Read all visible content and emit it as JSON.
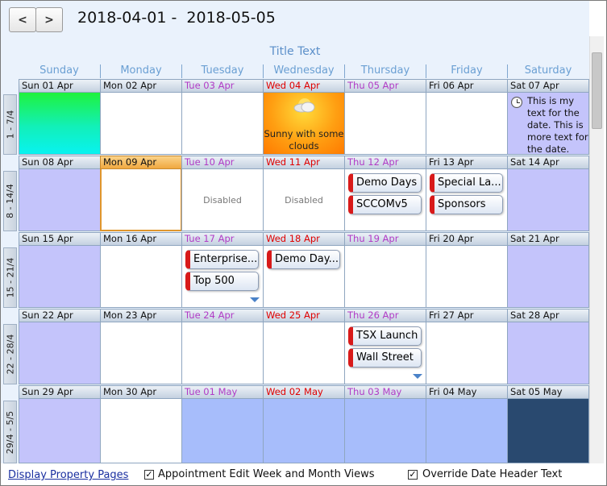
{
  "nav": {
    "prev_label": "<",
    "next_label": ">"
  },
  "date_range": "2018-04-01 -  2018-05-05",
  "title_text": "Title Text",
  "day_headers": [
    "Sunday",
    "Monday",
    "Tuesday",
    "Wednesday",
    "Thursday",
    "Friday",
    "Saturday"
  ],
  "weeks": [
    {
      "label": "1 - 7/4",
      "days": [
        "Sun 01 Apr",
        "Mon 02 Apr",
        "Tue 03 Apr",
        "Wed 04 Apr",
        "Thu 05 Apr",
        "Fri 06 Apr",
        "Sat 07 Apr"
      ]
    },
    {
      "label": "8 - 14/4",
      "days": [
        "Sun 08 Apr",
        "Mon 09 Apr",
        "Tue 10 Apr",
        "Wed 11 Apr",
        "Thu 12 Apr",
        "Fri 13 Apr",
        "Sat 14 Apr"
      ]
    },
    {
      "label": "15 - 21/4",
      "days": [
        "Sun 15 Apr",
        "Mon 16 Apr",
        "Tue 17 Apr",
        "Wed 18 Apr",
        "Thu 19 Apr",
        "Fri 20 Apr",
        "Sat 21 Apr"
      ]
    },
    {
      "label": "22 - 28/4",
      "days": [
        "Sun 22 Apr",
        "Mon 23 Apr",
        "Tue 24 Apr",
        "Wed 25 Apr",
        "Thu 26 Apr",
        "Fri 27 Apr",
        "Sat 28 Apr"
      ]
    },
    {
      "label": "29/4 - 5/5",
      "days": [
        "Sun 29 Apr",
        "Mon 30 Apr",
        "Tue 01 May",
        "Wed 02 May",
        "Thu 03 May",
        "Fri 04 May",
        "Sat 05 May"
      ]
    }
  ],
  "cells": {
    "weather": {
      "line1": "Sunny with some",
      "line2": "clouds"
    },
    "note": "This is my text for the date. This is more text for the date.",
    "disabled": "Disabled"
  },
  "appointments": {
    "thu_12": [
      "Demo Days",
      "SCCOMv5"
    ],
    "fri_13": [
      "Special La...",
      "Sponsors"
    ],
    "tue_17": [
      "Enterprise...",
      "Top 500"
    ],
    "wed_18": [
      "Demo Day..."
    ],
    "thu_26": [
      "TSX Launch",
      "Wall Street"
    ]
  },
  "bottom": {
    "link": "Display Property Pages",
    "check1": {
      "label": "Appointment Edit  Week and Month Views",
      "checked": true
    },
    "check2": {
      "label": "Override Date Header Text",
      "checked": true
    }
  },
  "colors": {
    "header_blue": "#6a9fd3",
    "weekday_purple": "#b13bc6",
    "wednesday_red": "#e00000",
    "lavender": "#c4c4fb",
    "light_blue": "#a7bdfb",
    "navy": "#29496f",
    "appt_accent": "#d81a1a"
  }
}
